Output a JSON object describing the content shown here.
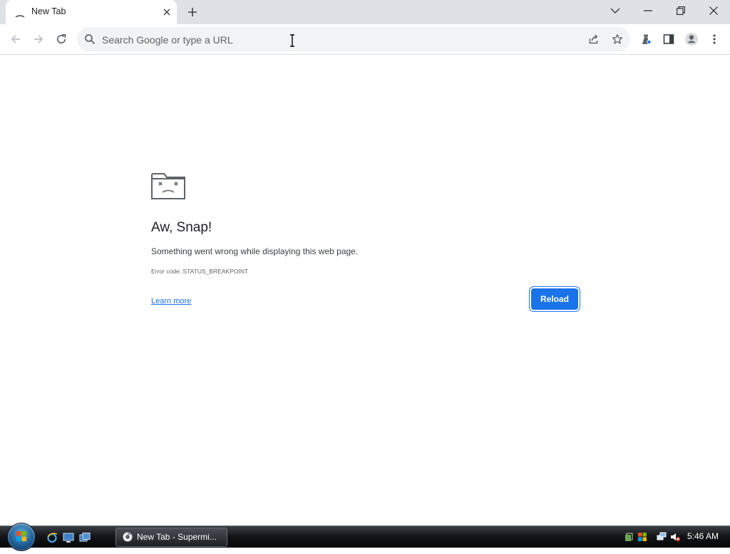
{
  "browser": {
    "tab_title": "New Tab",
    "omnibox_placeholder": "Search Google or type a URL"
  },
  "error_page": {
    "title": "Aw, Snap!",
    "description": "Something went wrong while displaying this web page.",
    "error_code": "Error code: STATUS_BREAKPOINT",
    "learn_more_label": "Learn more",
    "reload_label": "Reload"
  },
  "taskbar": {
    "task_label": "New Tab - Supermi...",
    "clock": "5:46 AM"
  },
  "colors": {
    "accent": "#1a73e8",
    "tabstrip_bg": "#dee1e6",
    "omnibox_bg": "#f1f3f4"
  },
  "icons": {
    "toolbar": [
      "back-icon",
      "forward-icon",
      "reload-icon",
      "search-icon",
      "share-icon",
      "star-icon",
      "extensions-icon",
      "side-panel-icon",
      "profile-icon",
      "menu-icon"
    ],
    "window": [
      "tab-search-icon",
      "minimize-icon",
      "restore-icon",
      "close-icon"
    ],
    "taskbar": [
      "start-orb",
      "ie-icon",
      "show-desktop-icon",
      "switch-windows-icon",
      "chrome-icon",
      "network-icon",
      "volume-muted-icon"
    ]
  }
}
